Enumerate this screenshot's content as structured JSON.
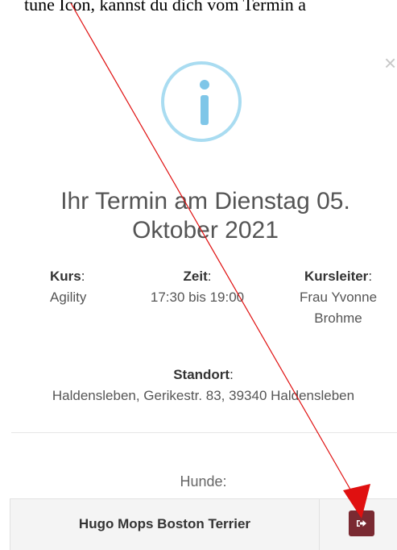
{
  "annotation": {
    "caption_text": "tune Icon, kannst du dich vom Termin a",
    "arrow_color": "#e01010"
  },
  "modal": {
    "close_glyph": "×",
    "icon": "info-icon",
    "title": "Ihr Termin am Dienstag 05. Oktober 2021",
    "kurs": {
      "label": "Kurs",
      "value": "Agility"
    },
    "zeit": {
      "label": "Zeit",
      "value": "17:30 bis 19:00"
    },
    "kursleiter": {
      "label": "Kursleiter",
      "value": "Frau Yvonne Brohme"
    },
    "standort": {
      "label": "Standort",
      "value": "Haldensleben, Gerikestr. 83, 39340 Haldensleben"
    },
    "hunde_label": "Hunde:",
    "dogs": [
      {
        "name": "Hugo Mops Boston Terrier",
        "action_icon": "sign-out-icon"
      }
    ]
  },
  "colors": {
    "info_ring": "#a9dcf1",
    "info_glyph": "#7fc6e8",
    "leave_button": "#7a2a32"
  }
}
